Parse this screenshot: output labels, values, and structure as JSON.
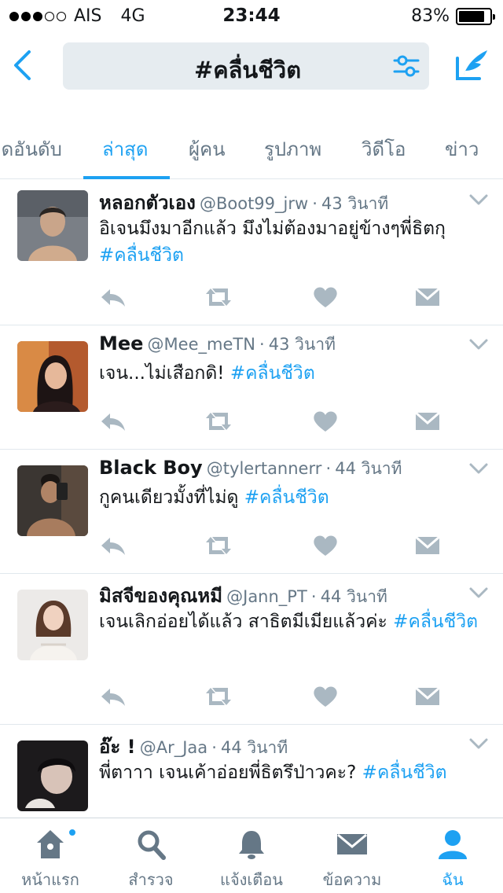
{
  "status_bar": {
    "carrier": "AIS",
    "network": "4G",
    "signal_bars": 3,
    "signal_total": 5,
    "time": "23:44",
    "battery_percent_label": "83%",
    "battery_level": 0.83
  },
  "header": {
    "search_query": "#คลื่นชีวิต",
    "accent_color": "#1da1f2"
  },
  "tabs": [
    {
      "label": "ติดอันดับ",
      "active": false
    },
    {
      "label": "ล่าสุด",
      "active": true
    },
    {
      "label": "ผู้คน",
      "active": false
    },
    {
      "label": "รูปภาพ",
      "active": false
    },
    {
      "label": "วิดีโอ",
      "active": false
    },
    {
      "label": "ข่าว",
      "active": false
    }
  ],
  "tweets": [
    {
      "name": "หลอกตัวเอง",
      "handle": "@Boot99_jrw",
      "time": "43 วินาที",
      "text": "อิเจนมึงมาอีกแล้ว มึงไม่ต้องมาอยู่ข้างๆพี่ธิตกุ ",
      "hashtag": "#คลื่นชีวิต"
    },
    {
      "name": "Mee",
      "handle": "@Mee_meTN",
      "time": "43 วินาที",
      "text": "เจน...ไม่เสือกดิ! ",
      "hashtag": "#คลื่นชีวิต"
    },
    {
      "name": "Black Boy",
      "handle": "@tylertannerr",
      "time": "44 วินาที",
      "text": "กูคนเดียวมั้งที่ไม่ดู ",
      "hashtag": "#คลื่นชีวิต"
    },
    {
      "name": "มิสจีของคุณหมี",
      "handle": "@Jann_PT",
      "time": "44 วินาที",
      "text": "เจนเลิกอ่อยได้แล้ว สาธิตมีเมียแล้วค่ะ ",
      "hashtag": "#คลื่นชีวิต"
    },
    {
      "name": "อ๊ะ !",
      "handle": "@Ar_Jaa",
      "time": "44 วินาที",
      "text": "พี่ตาาา เจนเค้าอ่อยพี่ธิตรึป่าวคะ? ",
      "hashtag": "#คลื่นชีวิต"
    }
  ],
  "tweet_meta_separator": "·",
  "tweet_icons": [
    "reply-icon",
    "retweet-icon",
    "like-icon",
    "direct-message-icon",
    "chevron-down-icon"
  ],
  "tab_bar": [
    {
      "label": "หน้าแรก",
      "icon": "home-icon",
      "active": false,
      "badge": true
    },
    {
      "label": "สำรวจ",
      "icon": "search-icon",
      "active": false,
      "badge": false
    },
    {
      "label": "แจ้งเตือน",
      "icon": "bell-icon",
      "active": false,
      "badge": false
    },
    {
      "label": "ข้อความ",
      "icon": "mail-icon",
      "active": false,
      "badge": false
    },
    {
      "label": "ฉัน",
      "icon": "profile-icon",
      "active": true,
      "badge": false
    }
  ]
}
